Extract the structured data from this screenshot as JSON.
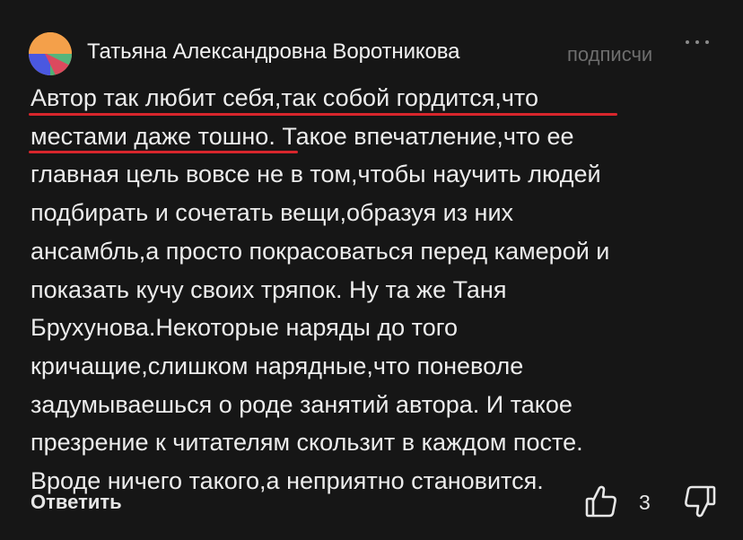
{
  "comment": {
    "author": "Татьяна Александровна Воротникова",
    "subscribe_label": "подписчи",
    "more_icon": "more-dots-icon",
    "text_lines": [
      "Автор так любит себя,так собой гордится,что",
      "местами даже тошно. Такое впечатление,что ее",
      "главная цель вовсе не в том,чтобы научить людей",
      "подбирать и сочетать вещи,образуя из них",
      "ансамбль,а просто покрасоваться перед камерой и",
      "показать кучу своих тряпок. Ну та же Таня",
      "Брухунова.Некоторые наряды до того",
      "кричащие,слишком нарядные,что поневоле",
      "задумываешься о роде занятий автора. И такое",
      "презрение к читателям скользит в каждом посте.",
      "Вроде ничего такого,а неприятно становится."
    ],
    "highlight_color": "#d8262c",
    "reply_label": "Ответить",
    "like_count": "3",
    "like_icon": "thumbs-up-icon",
    "dislike_icon": "thumbs-down-icon"
  }
}
